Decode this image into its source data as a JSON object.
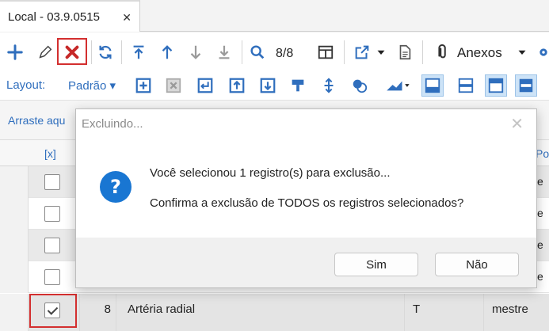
{
  "tab": {
    "title": "Local - 03.9.0515",
    "close": "✕"
  },
  "toolbar": {
    "record_count": "8/8",
    "anexos_label": "Anexos"
  },
  "layout_bar": {
    "label": "Layout:",
    "selected": "Padrão ▾"
  },
  "group_panel": {
    "hint": "Arraste aqu"
  },
  "grid": {
    "header_check": "[x]",
    "header_partial": "Po",
    "rows": [
      {
        "checked": false,
        "edge": "e"
      },
      {
        "checked": false,
        "edge": "e"
      },
      {
        "checked": false,
        "edge": "e"
      },
      {
        "checked": false,
        "edge": "e"
      }
    ],
    "selected_row": {
      "num": "8",
      "description": "Artéria radial",
      "type": "T",
      "owner": "mestre"
    }
  },
  "dialog": {
    "title": "Excluindo...",
    "close": "✕",
    "icon": "question-icon",
    "message1": "Você selecionou 1 registro(s) para exclusão...",
    "message2": "Confirma a exclusão de TODOS os registros selecionados?",
    "yes_label": "Sim",
    "no_label": "Não"
  },
  "colors": {
    "accent": "#1976d2",
    "link": "#2f6ebd",
    "highlight": "#d32f2f"
  }
}
